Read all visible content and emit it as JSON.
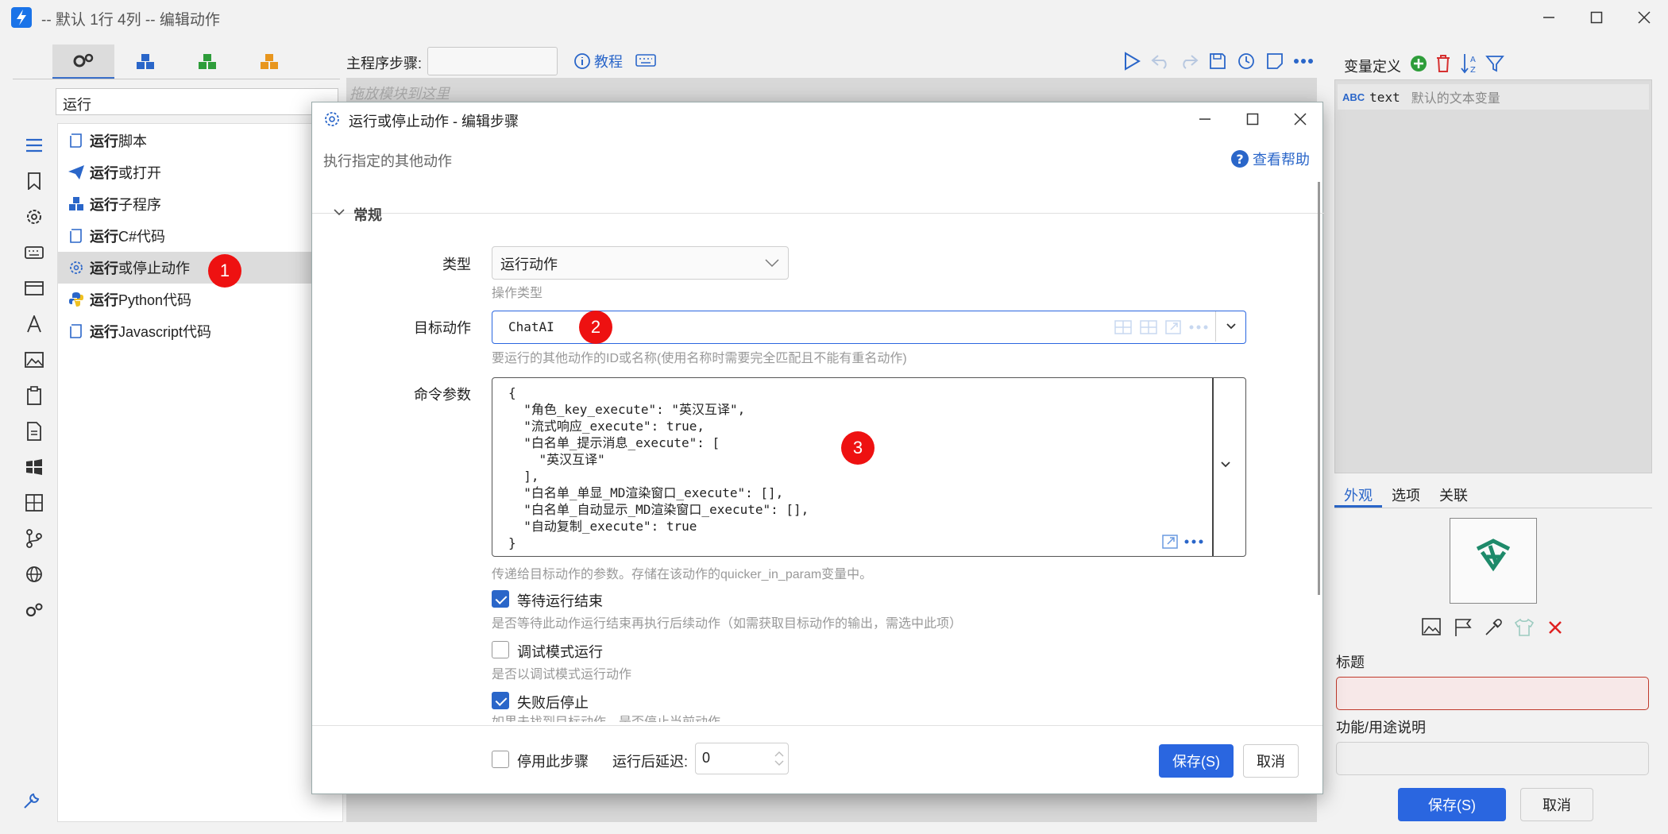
{
  "window": {
    "title": "-- 默认 1行 4列 -- 编辑动作"
  },
  "left": {
    "search_value": "运行",
    "items": [
      {
        "bold": "运行",
        "rest": "脚本"
      },
      {
        "bold": "运行",
        "rest": "或打开"
      },
      {
        "bold": "运行",
        "rest": "子程序"
      },
      {
        "bold": "运行",
        "rest": "C#代码"
      },
      {
        "bold": "运行",
        "rest": "或停止动作"
      },
      {
        "bold": "运行",
        "rest": "Python代码"
      },
      {
        "bold": "运行",
        "rest": "Javascript代码"
      }
    ]
  },
  "badges": {
    "b1": "1",
    "b2": "2",
    "b3": "3"
  },
  "toolbar": {
    "main_steps_label": "主程序步骤:",
    "main_steps_value": "",
    "tutorial": "教程"
  },
  "canvas": {
    "dropzone": "拖放模块到这里"
  },
  "vars": {
    "title": "变量定义",
    "items": [
      {
        "type": "ABC",
        "name": "text",
        "desc": "默认的文本变量"
      }
    ]
  },
  "props": {
    "tabs": [
      "外观",
      "选项",
      "关联"
    ],
    "title_label": "标题",
    "title_value": "",
    "desc_label": "功能/用途说明",
    "desc_value": "",
    "save": "保存(S)",
    "cancel": "取消"
  },
  "dialog": {
    "title": "运行或停止动作 - 编辑步骤",
    "desc": "执行指定的其他动作",
    "help": "查看帮助",
    "section": "常规",
    "type_label": "类型",
    "type_value": "运行动作",
    "type_hint": "操作类型",
    "target_label": "目标动作",
    "target_value": "ChatAI",
    "target_hint": "要运行的其他动作的ID或名称(使用名称时需要完全匹配且不能有重名动作)",
    "params_label": "命令参数",
    "params_lines": [
      "{",
      "  \"角色_key_execute\": \"英汉互译\",",
      "  \"流式响应_execute\": true,",
      "  \"白名单_提示消息_execute\": [",
      "    \"英汉互译\"",
      "  ],",
      "  \"白名单_单显_MD渲染窗口_execute\": [],",
      "  \"白名单_自动显示_MD渲染窗口_execute\": [],",
      "  \"自动复制_execute\": true",
      "}"
    ],
    "params_hint": "传递给目标动作的参数。存储在该动作的quicker_in_param变量中。",
    "wait_label": "等待运行结束",
    "wait_checked": true,
    "wait_hint": "是否等待此动作运行结束再执行后续动作（如需获取目标动作的输出，需选中此项）",
    "debug_label": "调试模式运行",
    "debug_checked": false,
    "debug_hint": "是否以调试模式运行动作",
    "stop_label": "失败后停止",
    "stop_checked": true,
    "stop_hint": "如果未找到目标动作，是否停止当前动作",
    "disable_label": "停用此步骤",
    "delay_label": "运行后延迟:",
    "delay_value": "0",
    "save": "保存(S)",
    "cancel": "取消"
  },
  "colors": {
    "accent": "#2a66e0",
    "badge": "#ee1111",
    "title_invalid_bg": "#f7e8e8",
    "title_invalid_border": "#c0392b"
  }
}
